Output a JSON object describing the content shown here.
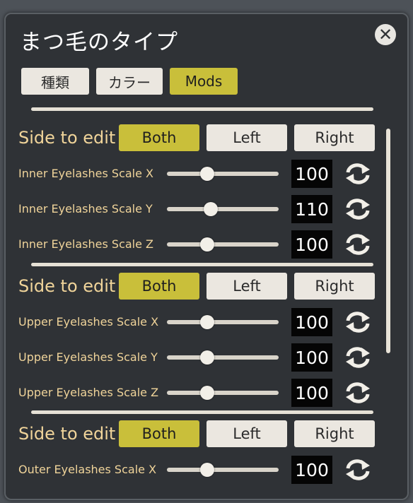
{
  "title": "まつ毛のタイプ",
  "close_icon": "close-icon",
  "tabs": [
    {
      "label": "種類",
      "active": false
    },
    {
      "label": "カラー",
      "active": false
    },
    {
      "label": "Mods",
      "active": true
    }
  ],
  "sections": [
    {
      "side_label": "Side to edit",
      "options": [
        {
          "label": "Both",
          "active": true
        },
        {
          "label": "Left",
          "active": false
        },
        {
          "label": "Right",
          "active": false
        }
      ],
      "rows": [
        {
          "label": "Inner Eyelashes Scale X",
          "value": "100",
          "slider_fraction": 0.36
        },
        {
          "label": "Inner Eyelashes Scale Y",
          "value": "110",
          "slider_fraction": 0.39
        },
        {
          "label": "Inner Eyelashes Scale Z",
          "value": "100",
          "slider_fraction": 0.36
        }
      ]
    },
    {
      "side_label": "Side to edit",
      "options": [
        {
          "label": "Both",
          "active": true
        },
        {
          "label": "Left",
          "active": false
        },
        {
          "label": "Right",
          "active": false
        }
      ],
      "rows": [
        {
          "label": "Upper Eyelashes Scale X",
          "value": "100",
          "slider_fraction": 0.36
        },
        {
          "label": "Upper Eyelashes Scale Y",
          "value": "100",
          "slider_fraction": 0.36
        },
        {
          "label": "Upper Eyelashes Scale Z",
          "value": "100",
          "slider_fraction": 0.36
        }
      ]
    },
    {
      "side_label": "Side to edit",
      "options": [
        {
          "label": "Both",
          "active": true
        },
        {
          "label": "Left",
          "active": false
        },
        {
          "label": "Right",
          "active": false
        }
      ],
      "rows": [
        {
          "label": "Outer Eyelashes Scale X",
          "value": "100",
          "slider_fraction": 0.36
        }
      ]
    }
  ],
  "reset_icon": "reset-arrows-icon",
  "colors": {
    "accent": "#c9bf3a",
    "label_text": "#f0d49a",
    "panel_bg": "#2f3236",
    "button_bg": "#ebe7e0",
    "value_bg": "#050505"
  }
}
